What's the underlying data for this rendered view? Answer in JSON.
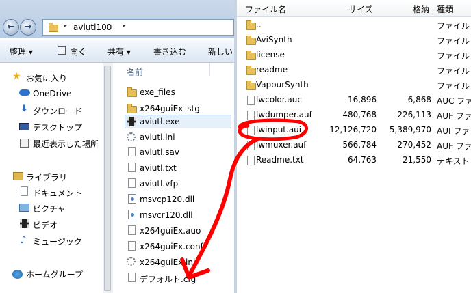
{
  "address": {
    "path": "aviutl100",
    "sep": "▸"
  },
  "toolbar": {
    "organize": "整理 ▾",
    "open": "開く",
    "share": "共有 ▾",
    "burn": "書き込む",
    "new": "新しい"
  },
  "nav": {
    "favorites": "お気に入り",
    "onedrive": "OneDrive",
    "downloads": "ダウンロード",
    "desktop": "デスクトップ",
    "recent": "最近表示した場所",
    "libraries": "ライブラリ",
    "documents": "ドキュメント",
    "pictures": "ピクチャ",
    "videos": "ビデオ",
    "music": "ミュージック",
    "homegroup": "ホームグループ"
  },
  "left_files": {
    "header": "名前",
    "items": [
      "exe_files",
      "x264guiEx_stg",
      "aviutl.exe",
      "aviutl.ini",
      "aviutl.sav",
      "aviutl.txt",
      "aviutl.vfp",
      "msvcp120.dll",
      "msvcr120.dll",
      "x264guiEx.auo",
      "x264guiEx.conf",
      "x264guiEx.ini",
      "デフォルト.cfg"
    ]
  },
  "right": {
    "headers": {
      "name": "ファイル名",
      "size": "サイズ",
      "packed": "格納",
      "type": "種類"
    },
    "rows": [
      {
        "name": "..",
        "size": "",
        "packed": "",
        "type": "ファイル"
      },
      {
        "name": "AviSynth",
        "size": "",
        "packed": "",
        "type": "ファイル"
      },
      {
        "name": "license",
        "size": "",
        "packed": "",
        "type": "ファイル"
      },
      {
        "name": "readme",
        "size": "",
        "packed": "",
        "type": "ファイル"
      },
      {
        "name": "VapourSynth",
        "size": "",
        "packed": "",
        "type": "ファイル"
      },
      {
        "name": "lwcolor.auc",
        "size": "16,896",
        "packed": "6,868",
        "type": "AUC ファ"
      },
      {
        "name": "lwdumper.auf",
        "size": "480,768",
        "packed": "226,113",
        "type": "AUF ファ"
      },
      {
        "name": "lwinput.aui",
        "size": "12,126,720",
        "packed": "5,389,970",
        "type": "AUI ファ"
      },
      {
        "name": "lwmuxer.auf",
        "size": "566,784",
        "packed": "270,452",
        "type": "AUF ファ"
      },
      {
        "name": "Readme.txt",
        "size": "64,763",
        "packed": "21,550",
        "type": "テキスト"
      }
    ]
  },
  "colors": {
    "annotation": "#ff0000",
    "selection": "#e5f0fb"
  }
}
